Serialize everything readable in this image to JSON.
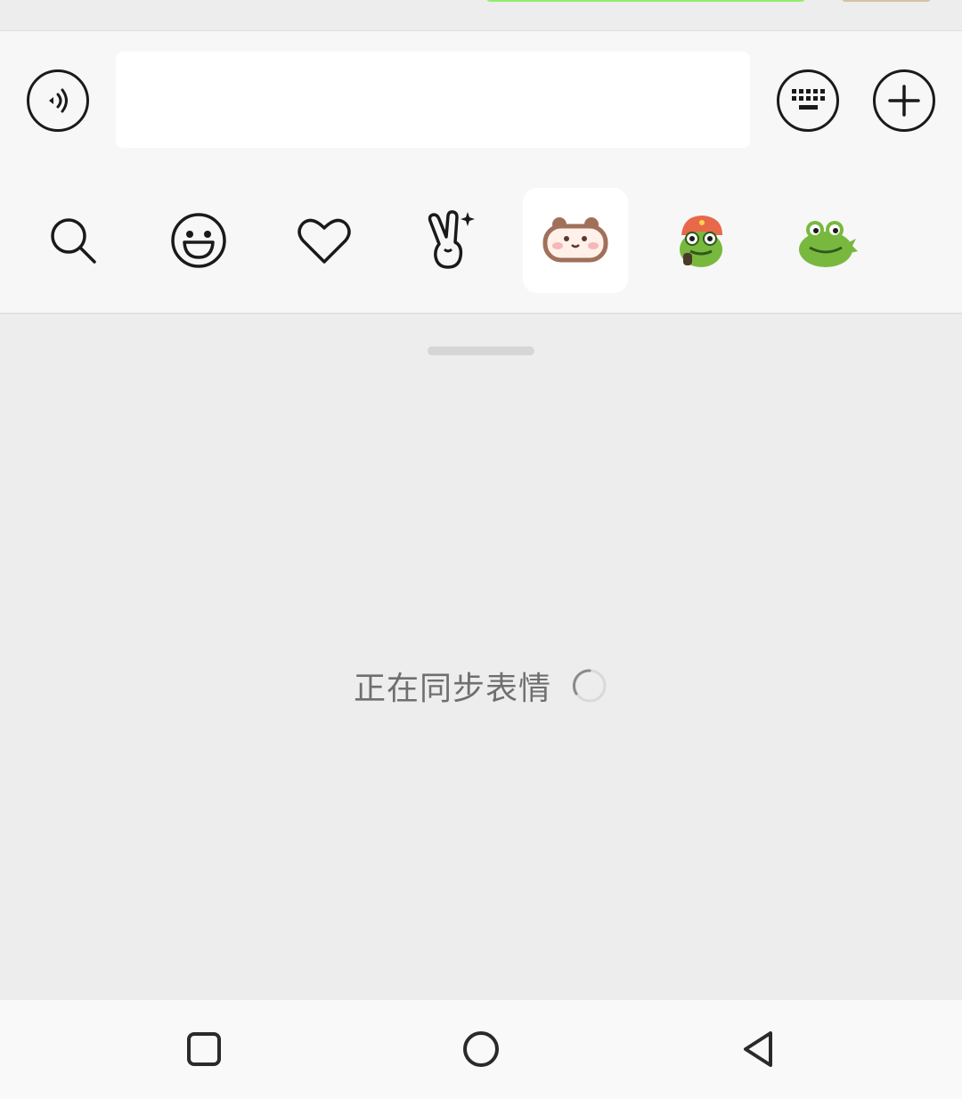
{
  "input_bar": {
    "voice_icon": "voice-icon",
    "message_placeholder": "",
    "message_value": "",
    "keyboard_icon": "keyboard-icon",
    "more_icon": "plus-icon"
  },
  "emoji_tabs": [
    {
      "icon": "search-icon",
      "selected": false
    },
    {
      "icon": "smiley-icon",
      "selected": false
    },
    {
      "icon": "heart-icon",
      "selected": false
    },
    {
      "icon": "victory-hand-icon",
      "selected": false
    },
    {
      "icon": "bear-sticker-icon",
      "selected": true
    },
    {
      "icon": "frog-hat-sticker-icon",
      "selected": false
    },
    {
      "icon": "frog-sticker-icon",
      "selected": false
    }
  ],
  "panel": {
    "status_text": "正在同步表情",
    "loading_icon": "spinner-icon"
  },
  "nav_bar": {
    "recent_icon": "square-icon",
    "home_icon": "circle-icon",
    "back_icon": "triangle-back-icon"
  },
  "colors": {
    "background": "#f7f7f7",
    "panel": "#ededed",
    "bubble_green": "#95ec69",
    "text_gray": "#6f6f6f"
  }
}
